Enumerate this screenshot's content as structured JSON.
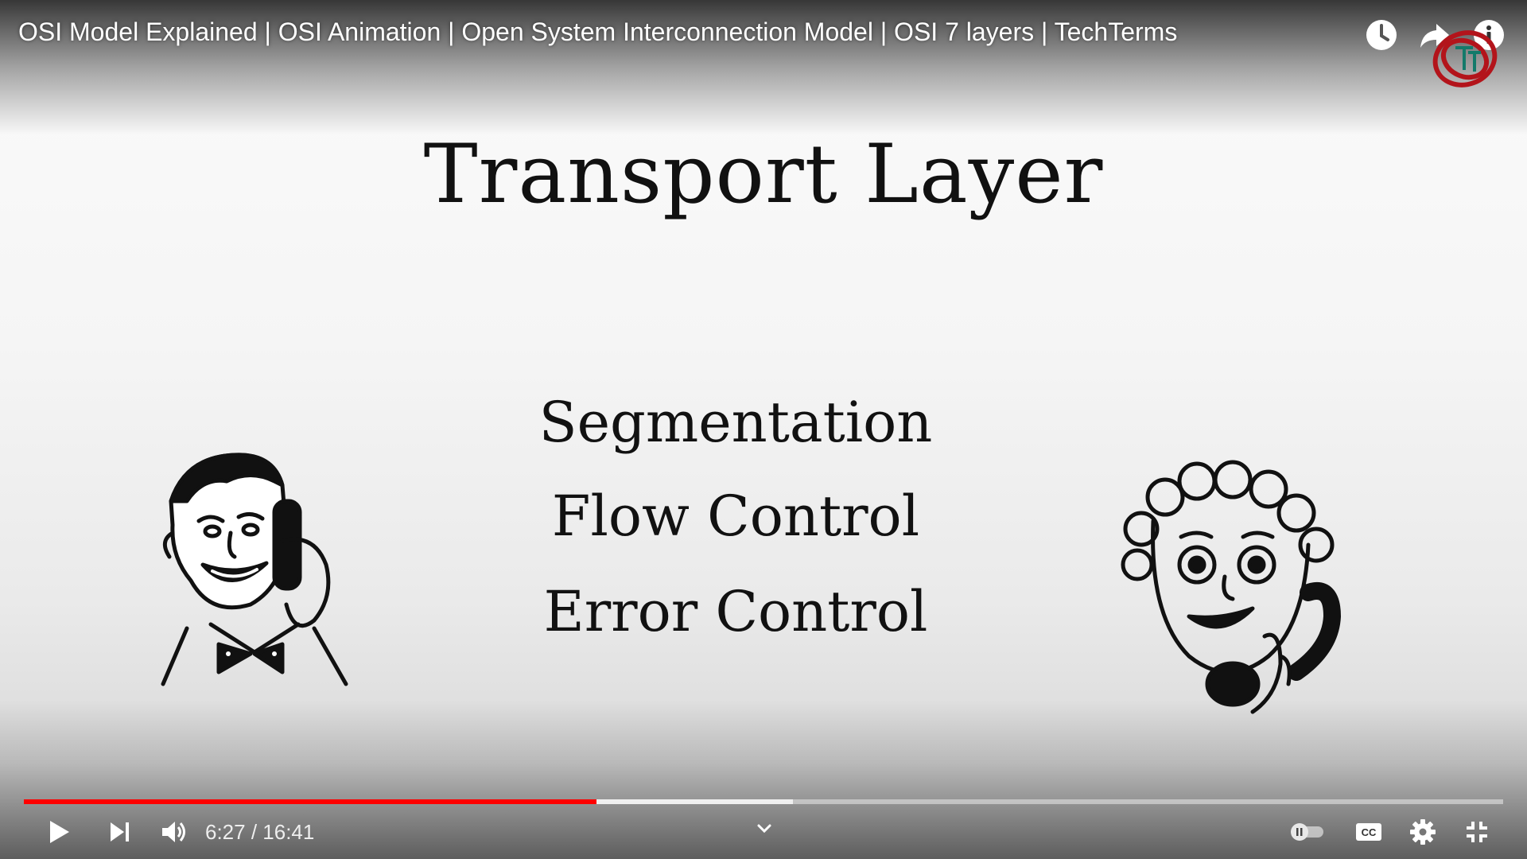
{
  "player": {
    "video_title": "OSI Model Explained | OSI Animation | Open System Interconnection Model | OSI 7 layers | TechTerms",
    "current_time": "6:27",
    "duration": "16:41",
    "time_display": "6:27 / 16:41",
    "progress_fraction": 0.387,
    "buffered_fraction": 0.52,
    "accent_color": "#ff0000",
    "icons": {
      "watch_later": "clock-icon",
      "share": "share-icon",
      "info": "info-icon",
      "play": "play-icon",
      "next": "next-icon",
      "volume": "volume-icon",
      "chapters": "chevron-down-icon",
      "autoplay": "autoplay-toggle-icon",
      "captions": "cc-icon",
      "settings": "gear-icon",
      "fullscreen": "exit-fullscreen-icon"
    }
  },
  "slide": {
    "heading": "Transport Layer",
    "items": [
      "Segmentation",
      "Flow Control",
      "Error Control"
    ]
  }
}
